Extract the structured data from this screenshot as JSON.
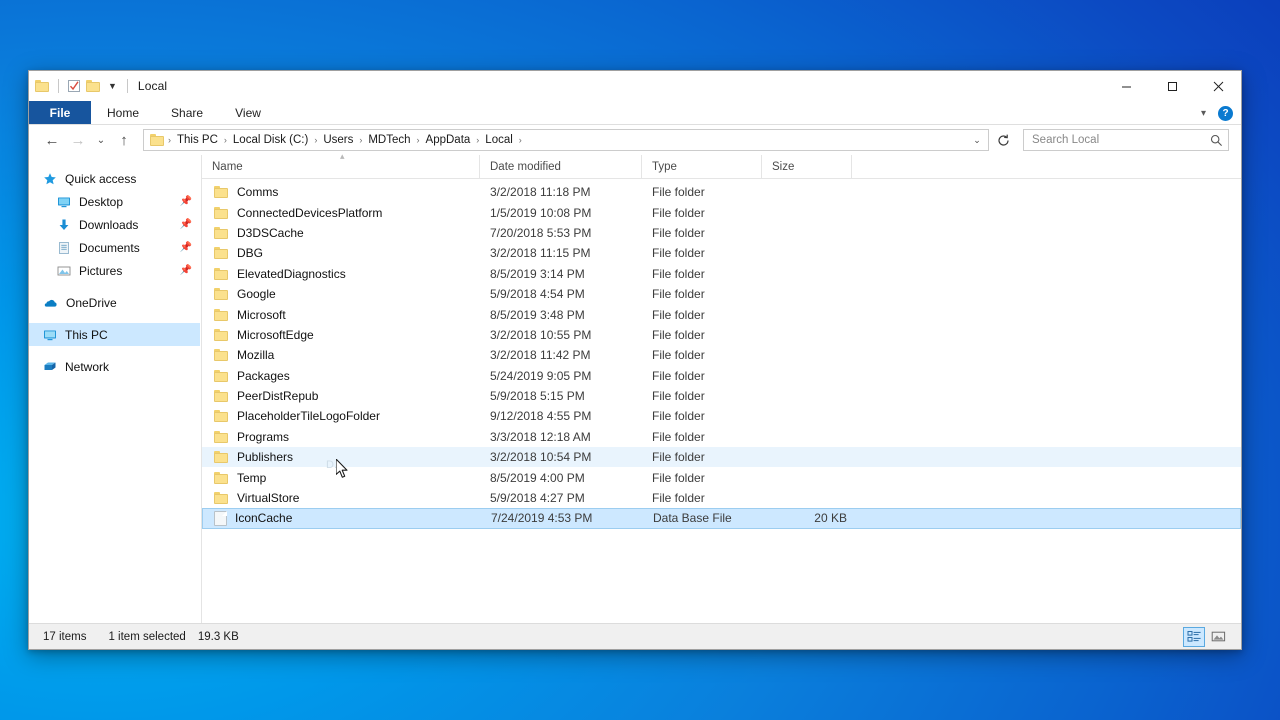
{
  "window": {
    "title": "Local",
    "quick_access_toolbar": [
      {
        "name": "folder-icon",
        "label": "Folder"
      },
      {
        "name": "properties-icon",
        "label": "Properties"
      },
      {
        "name": "new-folder-icon",
        "label": "New folder"
      },
      {
        "name": "chevron-down-icon",
        "label": "Customize Quick Access Toolbar"
      }
    ],
    "controls": {
      "minimize": "—",
      "maximize": "□",
      "close": "✕",
      "ribbon_collapse": "⌄",
      "help": "?"
    }
  },
  "ribbon": {
    "tabs": [
      {
        "label": "File",
        "active": true
      },
      {
        "label": "Home",
        "active": false
      },
      {
        "label": "Share",
        "active": false
      },
      {
        "label": "View",
        "active": false
      }
    ]
  },
  "navigation": {
    "back": "←",
    "forward": "→",
    "recent_locations": "⌄",
    "up": "↑",
    "refresh": "↻",
    "breadcrumb_dropdown": "⌄",
    "breadcrumbs": [
      "This PC",
      "Local Disk (C:)",
      "Users",
      "MDTech",
      "AppData",
      "Local"
    ],
    "separator": "›"
  },
  "search": {
    "placeholder": "Search Local",
    "icon": "search-icon"
  },
  "sidebar": {
    "items": [
      {
        "label": "Quick access",
        "icon": "star-icon",
        "indent": false,
        "pinned": false,
        "selected": false
      },
      {
        "label": "Desktop",
        "icon": "desktop-icon",
        "indent": true,
        "pinned": true,
        "selected": false
      },
      {
        "label": "Downloads",
        "icon": "downloads-icon",
        "indent": true,
        "pinned": true,
        "selected": false
      },
      {
        "label": "Documents",
        "icon": "documents-icon",
        "indent": true,
        "pinned": true,
        "selected": false
      },
      {
        "label": "Pictures",
        "icon": "pictures-icon",
        "indent": true,
        "pinned": true,
        "selected": false
      },
      {
        "label": "OneDrive",
        "icon": "onedrive-cloud-icon",
        "indent": false,
        "pinned": false,
        "selected": false
      },
      {
        "label": "This PC",
        "icon": "this-pc-icon",
        "indent": false,
        "pinned": false,
        "selected": true
      },
      {
        "label": "Network",
        "icon": "network-icon",
        "indent": false,
        "pinned": false,
        "selected": false
      }
    ],
    "pin_glyph": "📌"
  },
  "file_list": {
    "columns": [
      {
        "key": "name",
        "label": "Name",
        "sorted": "asc"
      },
      {
        "key": "date",
        "label": "Date modified",
        "sorted": null
      },
      {
        "key": "type",
        "label": "Type",
        "sorted": null
      },
      {
        "key": "size",
        "label": "Size",
        "sorted": null
      }
    ],
    "sort_caret": "▴",
    "rows": [
      {
        "name": "Comms",
        "date": "3/2/2018 11:18 PM",
        "type": "File folder",
        "size": "",
        "icon": "folder-icon",
        "state": ""
      },
      {
        "name": "ConnectedDevicesPlatform",
        "date": "1/5/2019 10:08 PM",
        "type": "File folder",
        "size": "",
        "icon": "folder-icon",
        "state": ""
      },
      {
        "name": "D3DSCache",
        "date": "7/20/2018 5:53 PM",
        "type": "File folder",
        "size": "",
        "icon": "folder-icon",
        "state": ""
      },
      {
        "name": "DBG",
        "date": "3/2/2018 11:15 PM",
        "type": "File folder",
        "size": "",
        "icon": "folder-icon",
        "state": ""
      },
      {
        "name": "ElevatedDiagnostics",
        "date": "8/5/2019 3:14 PM",
        "type": "File folder",
        "size": "",
        "icon": "folder-icon",
        "state": ""
      },
      {
        "name": "Google",
        "date": "5/9/2018 4:54 PM",
        "type": "File folder",
        "size": "",
        "icon": "folder-icon",
        "state": ""
      },
      {
        "name": "Microsoft",
        "date": "8/5/2019 3:48 PM",
        "type": "File folder",
        "size": "",
        "icon": "folder-icon",
        "state": ""
      },
      {
        "name": "MicrosoftEdge",
        "date": "3/2/2018 10:55 PM",
        "type": "File folder",
        "size": "",
        "icon": "folder-icon",
        "state": ""
      },
      {
        "name": "Mozilla",
        "date": "3/2/2018 11:42 PM",
        "type": "File folder",
        "size": "",
        "icon": "folder-icon",
        "state": ""
      },
      {
        "name": "Packages",
        "date": "5/24/2019 9:05 PM",
        "type": "File folder",
        "size": "",
        "icon": "folder-icon",
        "state": ""
      },
      {
        "name": "PeerDistRepub",
        "date": "5/9/2018 5:15 PM",
        "type": "File folder",
        "size": "",
        "icon": "folder-icon",
        "state": ""
      },
      {
        "name": "PlaceholderTileLogoFolder",
        "date": "9/12/2018 4:55 PM",
        "type": "File folder",
        "size": "",
        "icon": "folder-icon",
        "state": ""
      },
      {
        "name": "Programs",
        "date": "3/3/2018 12:18 AM",
        "type": "File folder",
        "size": "",
        "icon": "folder-icon",
        "state": ""
      },
      {
        "name": "Publishers",
        "date": "3/2/2018 10:54 PM",
        "type": "File folder",
        "size": "",
        "icon": "folder-icon",
        "state": "hover"
      },
      {
        "name": "Temp",
        "date": "8/5/2019 4:00 PM",
        "type": "File folder",
        "size": "",
        "icon": "folder-icon",
        "state": ""
      },
      {
        "name": "VirtualStore",
        "date": "5/9/2018 4:27 PM",
        "type": "File folder",
        "size": "",
        "icon": "folder-icon",
        "state": ""
      },
      {
        "name": "IconCache",
        "date": "7/24/2019 4:53 PM",
        "type": "Data Base File",
        "size": "20 KB",
        "icon": "database-file-icon",
        "state": "selected"
      }
    ]
  },
  "status_bar": {
    "item_count": "17 items",
    "selection": "1 item selected",
    "selection_size": "19.3 KB",
    "views": [
      {
        "name": "details-view-button",
        "active": true
      },
      {
        "name": "large-icons-view-button",
        "active": false
      }
    ]
  },
  "colors": {
    "accent": "#17559e",
    "selection": "#cde8ff",
    "hover": "#e9f4fd",
    "nav_selection": "#cce8ff",
    "folder": "#fbe18d",
    "help_blue": "#0a7ad0",
    "desktop_top": "#0a39b8",
    "desktop_light": "#00b0f0"
  }
}
